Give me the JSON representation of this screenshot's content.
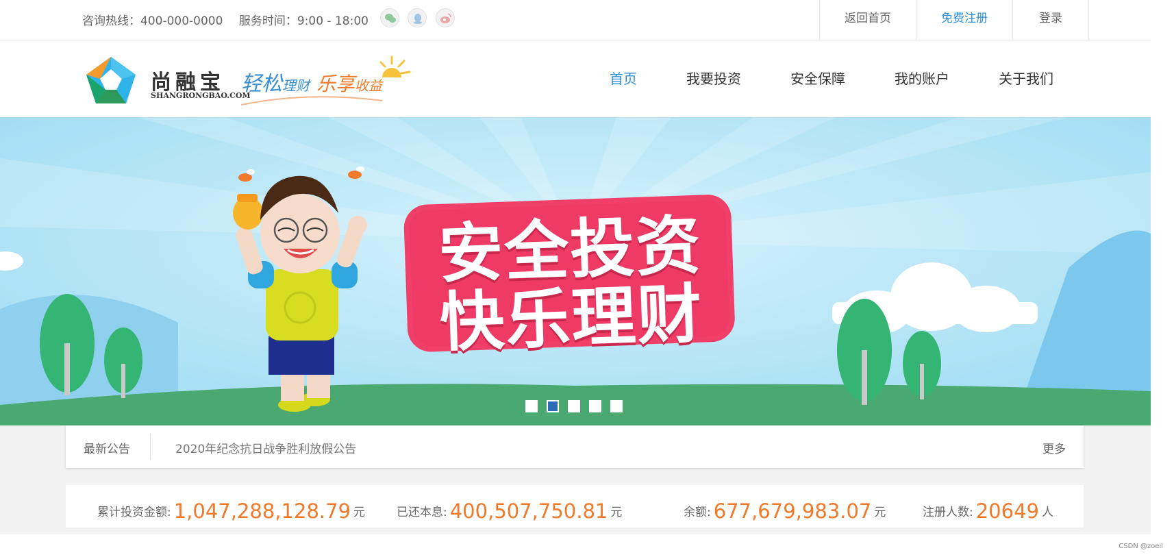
{
  "topbar": {
    "hotline": "咨询热线：400-000-0000",
    "hours": "服务时间：9:00 - 18:00",
    "social_icons": [
      "wechat-icon",
      "qq-icon",
      "weibo-icon"
    ],
    "links": [
      {
        "label": "返回首页"
      },
      {
        "label": "免费注册"
      },
      {
        "label": "登录"
      }
    ]
  },
  "header": {
    "brand_cn": "尚融宝",
    "brand_en": "SHANGRONGBAO.COM",
    "slogan": {
      "part1_big": "轻松",
      "part1_small": "理财",
      "part2_big": "乐享",
      "part2_small": "收益"
    },
    "nav": [
      {
        "label": "首页",
        "active": true
      },
      {
        "label": "我要投资"
      },
      {
        "label": "安全保障"
      },
      {
        "label": "我的账户"
      },
      {
        "label": "关于我们"
      }
    ]
  },
  "banner": {
    "line1": "安全投资",
    "line2": "快乐理财",
    "slides": 5,
    "active_slide": 2
  },
  "notice": {
    "label": "最新公告",
    "text": "2020年纪念抗日战争胜利放假公告",
    "more": "更多"
  },
  "stats": [
    {
      "label": "累计投资金额:",
      "value": "1,047,288,128.79",
      "unit": "元"
    },
    {
      "label": "已还本息:",
      "value": "400,507,750.81",
      "unit": "元"
    },
    {
      "label": "余额:",
      "value": "677,679,983.07",
      "unit": "元"
    },
    {
      "label": "注册人数:",
      "value": "20649",
      "unit": "人"
    }
  ],
  "watermark": "CSDN @zoeil",
  "colors": {
    "accent_blue": "#2a8fd6",
    "accent_orange": "#f0792a",
    "banner_sky": "#a8e0f5",
    "banner_title": "#f0406a"
  }
}
